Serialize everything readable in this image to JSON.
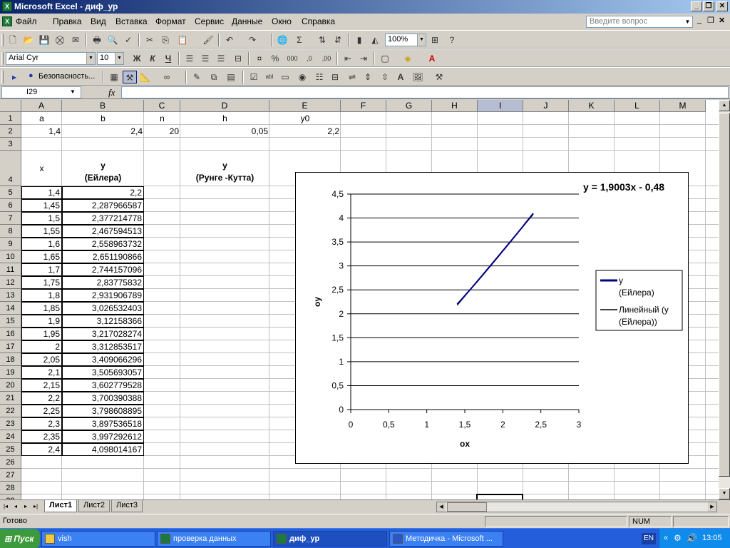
{
  "window": {
    "title": "Microsoft Excel - диф_ур",
    "app_icon": "excel-icon"
  },
  "menu": {
    "items": [
      "Файл",
      "Правка",
      "Вид",
      "Вставка",
      "Формат",
      "Сервис",
      "Данные",
      "Окно",
      "Справка"
    ],
    "help_placeholder": "Введите вопрос"
  },
  "toolbar": {
    "zoom": "100%",
    "font": "Arial Cyr",
    "size": "10",
    "bold": "Ж",
    "italic": "К",
    "underline": "Ч",
    "security": "Безопасность..."
  },
  "formula": {
    "namebox": "I29",
    "fx": "fx",
    "content": ""
  },
  "columns": [
    {
      "label": "A",
      "w": 57
    },
    {
      "label": "B",
      "w": 115
    },
    {
      "label": "C",
      "w": 51
    },
    {
      "label": "D",
      "w": 125
    },
    {
      "label": "E",
      "w": 100
    },
    {
      "label": "F",
      "w": 64
    },
    {
      "label": "G",
      "w": 64
    },
    {
      "label": "H",
      "w": 64
    },
    {
      "label": "I",
      "w": 64,
      "selected": true
    },
    {
      "label": "J",
      "w": 64
    },
    {
      "label": "K",
      "w": 64
    },
    {
      "label": "L",
      "w": 64
    },
    {
      "label": "M",
      "w": 64
    }
  ],
  "rows": [
    "1",
    "2",
    "3",
    "4",
    "5",
    "6",
    "7",
    "8",
    "9",
    "10",
    "11",
    "12",
    "13",
    "14",
    "15",
    "16",
    "17",
    "18",
    "19",
    "20",
    "21",
    "22",
    "23",
    "24",
    "25",
    "26",
    "27",
    "28",
    "29"
  ],
  "header_cells": {
    "a": "a",
    "b": "b",
    "n": "n",
    "h": "h",
    "y0": "y0",
    "a_val": "1,4",
    "b_val": "2,4",
    "n_val": "20",
    "h_val": "0,05",
    "y0_val": "2,2",
    "x_label": "x",
    "y_label": "y",
    "euler_label": "(Ейлера)",
    "rk_y": "y",
    "rk_label": "(Рунге -Кутта)"
  },
  "table": {
    "x": [
      "1,4",
      "1,45",
      "1,5",
      "1,55",
      "1,6",
      "1,65",
      "1,7",
      "1,75",
      "1,8",
      "1,85",
      "1,9",
      "1,95",
      "2",
      "2,05",
      "2,1",
      "2,15",
      "2,2",
      "2,25",
      "2,3",
      "2,35",
      "2,4"
    ],
    "y": [
      "2,2",
      "2,287966587",
      "2,377214778",
      "2,467594513",
      "2,558963732",
      "2,651190866",
      "2,744157096",
      "2,83775832",
      "2,931906789",
      "3,026532403",
      "3,12158366",
      "3,217028274",
      "3,312853517",
      "3,409066296",
      "3,505693057",
      "3,602779528",
      "3,700390388",
      "3,798608895",
      "3,897536518",
      "3,997292612",
      "4,098014167"
    ]
  },
  "chart_data": {
    "type": "line",
    "x": [
      1.4,
      1.45,
      1.5,
      1.55,
      1.6,
      1.65,
      1.7,
      1.75,
      1.8,
      1.85,
      1.9,
      1.95,
      2.0,
      2.05,
      2.1,
      2.15,
      2.2,
      2.25,
      2.3,
      2.35,
      2.4
    ],
    "series": [
      {
        "name": "y (Ейлера)",
        "values": [
          2.2,
          2.287966587,
          2.377214778,
          2.467594513,
          2.558963732,
          2.651190866,
          2.744157096,
          2.83775832,
          2.931906789,
          3.026532403,
          3.12158366,
          3.217028274,
          3.312853517,
          3.409066296,
          3.505693057,
          3.602779528,
          3.700390388,
          3.798608895,
          3.897536518,
          3.997292612,
          4.098014167
        ],
        "color": "#000080"
      },
      {
        "name": "Линейный (y (Ейлера))",
        "trendline": {
          "slope": 1.9003,
          "intercept": -0.48
        },
        "color": "#000000"
      }
    ],
    "equation": "y = 1,9003x - 0,48",
    "xlabel": "ox",
    "ylabel": "oy",
    "xlim": [
      0,
      3
    ],
    "ylim": [
      0,
      4.5
    ],
    "xticks": [
      "0",
      "0,5",
      "1",
      "1,5",
      "2",
      "2,5",
      "3"
    ],
    "yticks": [
      "0",
      "0,5",
      "1",
      "1,5",
      "2",
      "2,5",
      "3",
      "3,5",
      "4",
      "4,5"
    ],
    "legend": [
      "y",
      "(Ейлера)",
      "Линейный (y",
      "(Ейлера))"
    ],
    "legend_position": "right",
    "grid": "horizontal"
  },
  "sheets": [
    "Лист1",
    "Лист2",
    "Лист3"
  ],
  "status": {
    "left": "Готово",
    "num": "NUM"
  },
  "taskbar": {
    "start": "Пуск",
    "tasks": [
      "vish",
      "проверка данных",
      "диф_ур",
      "Методичка - Microsoft ..."
    ],
    "lang": "EN",
    "time": "13:05"
  }
}
